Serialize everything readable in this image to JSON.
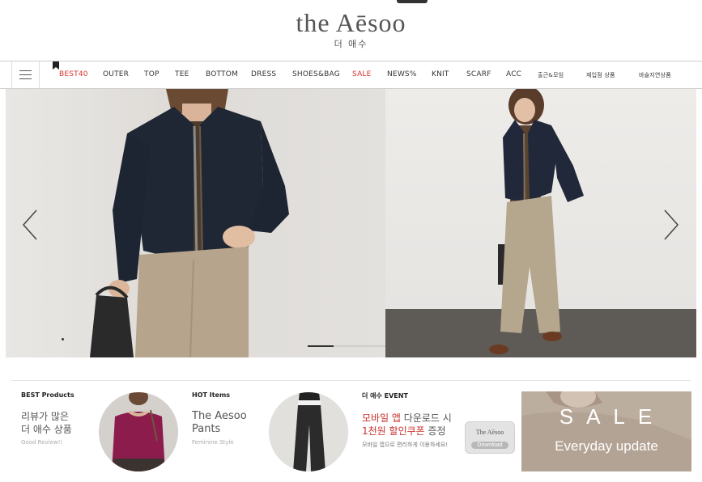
{
  "header": {
    "logo_main": "the Aēsoo",
    "logo_sub": "더 애수"
  },
  "nav": {
    "items": [
      {
        "label": "BEST40",
        "highlight": true
      },
      {
        "label": "OUTER",
        "highlight": false
      },
      {
        "label": "TOP",
        "highlight": false
      },
      {
        "label": "TEE",
        "highlight": false
      },
      {
        "label": "BOTTOM",
        "highlight": false
      },
      {
        "label": "DRESS",
        "highlight": false
      },
      {
        "label": "SHOES&BAG",
        "highlight": false
      },
      {
        "label": "SALE",
        "highlight": true
      },
      {
        "label": "NEWS%",
        "highlight": false
      },
      {
        "label": "KNIT",
        "highlight": false
      },
      {
        "label": "SCARF",
        "highlight": false
      },
      {
        "label": "ACC",
        "highlight": false
      },
      {
        "label": "출근&모임",
        "highlight": false
      },
      {
        "label": "재입점 상품",
        "highlight": false
      },
      {
        "label": "바슬지연상품",
        "highlight": false
      }
    ],
    "accent_color": "#d9322e"
  },
  "hero": {
    "prev_icon": "chevron-left-icon",
    "next_icon": "chevron-right-icon"
  },
  "promos": {
    "best": {
      "heading": "BEST Products",
      "line1": "리뷰가 많은",
      "line2": "더 애수 상품",
      "small": "Good Review!!"
    },
    "hot": {
      "heading": "HOT Items",
      "line1": "The Aesoo",
      "line2": "Pants",
      "small": "Feminine Style"
    },
    "event": {
      "heading": "더 애수 EVENT",
      "line1_red": "모바일 앱",
      "line1_rest": " 다운로드 시",
      "line2_red": "1천원 할인쿠폰",
      "line2_rest": " 증정",
      "small": "모바일 앱으로 편리하게 이용하세요!",
      "badge_title": "The Aēsoo",
      "badge_button": "Download"
    },
    "sale": {
      "title": "SALE",
      "subtitle": "Everyday update"
    }
  }
}
